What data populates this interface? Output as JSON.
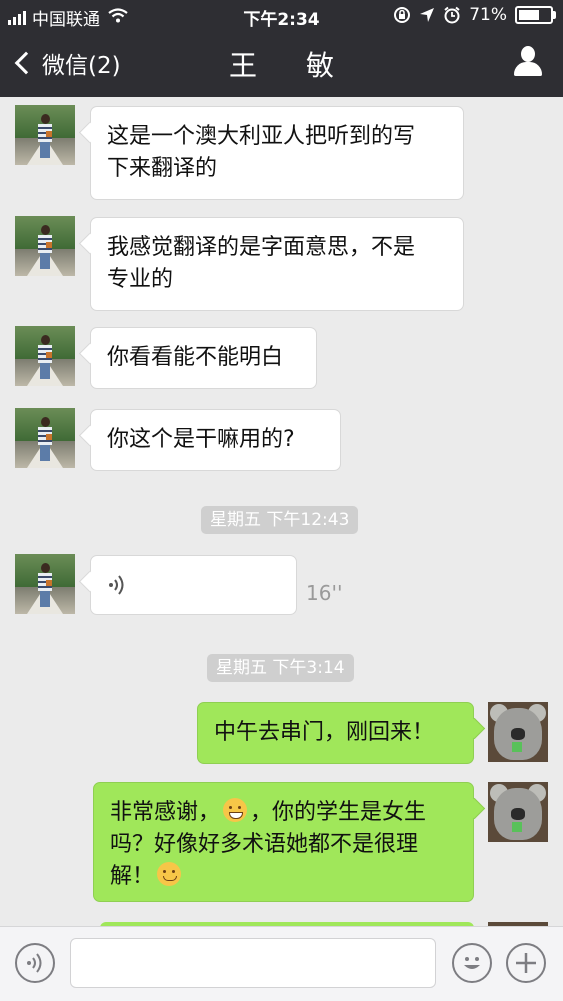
{
  "status_bar": {
    "carrier": "中国联通",
    "time": "下午2:34",
    "battery": "71%",
    "battery_fraction": 0.71
  },
  "nav": {
    "back_label": "微信(2)",
    "title": "王 敏"
  },
  "messages": [
    {
      "text": "这是一个澳大利亚人把听到的写\n下来翻译的"
    },
    {
      "text": "我感觉翻译的是字面意思，不是\n专业的"
    },
    {
      "text": "你看看能不能明白"
    },
    {
      "text": "你这个是干嘛用的?"
    }
  ],
  "timestamps": [
    "星期五 下午12:43",
    "星期五 下午3:14"
  ],
  "voice": {
    "duration": "16''"
  },
  "outgoing": [
    {
      "text": "中午去串门，刚回来！"
    },
    {
      "line1_a": "非常感谢，",
      "line1_b": "，你的学生是女生",
      "line2": "吗？好像好多术语她都不是很理",
      "line3": "解！"
    }
  ],
  "input": {
    "placeholder": ""
  },
  "icons": [
    "signal-icon",
    "wifi-icon",
    "lock-rotation-icon",
    "location-icon",
    "alarm-icon",
    "battery-icon",
    "back-chevron-icon",
    "profile-icon",
    "voice-wave-icon",
    "voice-input-icon",
    "emoji-icon",
    "plus-icon",
    "grin-emoji",
    "blush-emoji"
  ],
  "colors": {
    "nav_bg": "#2e2e33",
    "chat_bg": "#ebebeb",
    "outgoing_bubble": "#a0e75a",
    "incoming_bubble": "#ffffff"
  }
}
